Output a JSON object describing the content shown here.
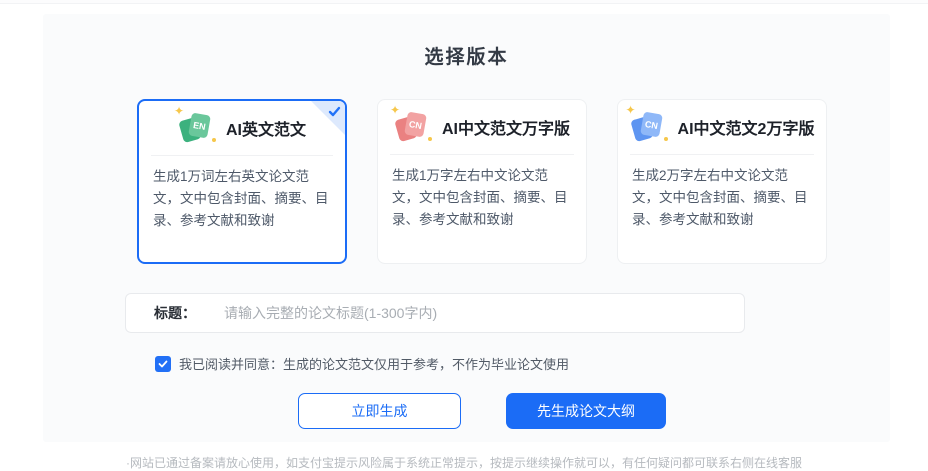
{
  "page": {
    "title": "选择版本",
    "footer": "·网站已通过备案请放心使用，如支付宝提示风险属于系统正常提示，按提示继续操作就可以，有任何疑问都可联系右侧在线客服"
  },
  "versions": [
    {
      "name": "AI英文范文",
      "badge": "EN",
      "description": "生成1万词左右英文论文范文，文中包含封面、摘要、目录、参考文献和致谢",
      "selected": true
    },
    {
      "name": "AI中文范文万字版",
      "badge": "CN",
      "description": "生成1万字左右中文论文范文，文中包含封面、摘要、目录、参考文献和致谢",
      "selected": false
    },
    {
      "name": "AI中文范文2万字版",
      "badge": "CN",
      "description": "生成2万字左右中文论文范文，文中包含封面、摘要、目录、参考文献和致谢",
      "selected": false
    }
  ],
  "form": {
    "title_label": "标题：",
    "title_placeholder": "请输入完整的论文标题(1-300字内)",
    "agreement_text": "我已阅读并同意：生成的论文范文仅用于参考，不作为毕业论文使用",
    "agreement_checked": true,
    "generate_now_label": "立即生成",
    "generate_outline_label": "先生成论文大纲"
  },
  "colors": {
    "accent_blue": "#1b6cf6",
    "selected_corner_fill": "#dde9fd",
    "en_icon_green": "#6ac79b",
    "cn_icon_pink": "#f2a2a2",
    "cn_icon_blue": "#8fb8f8",
    "sparkle_yellow": "#f6c74b",
    "panel_background": "#fafbfc"
  }
}
